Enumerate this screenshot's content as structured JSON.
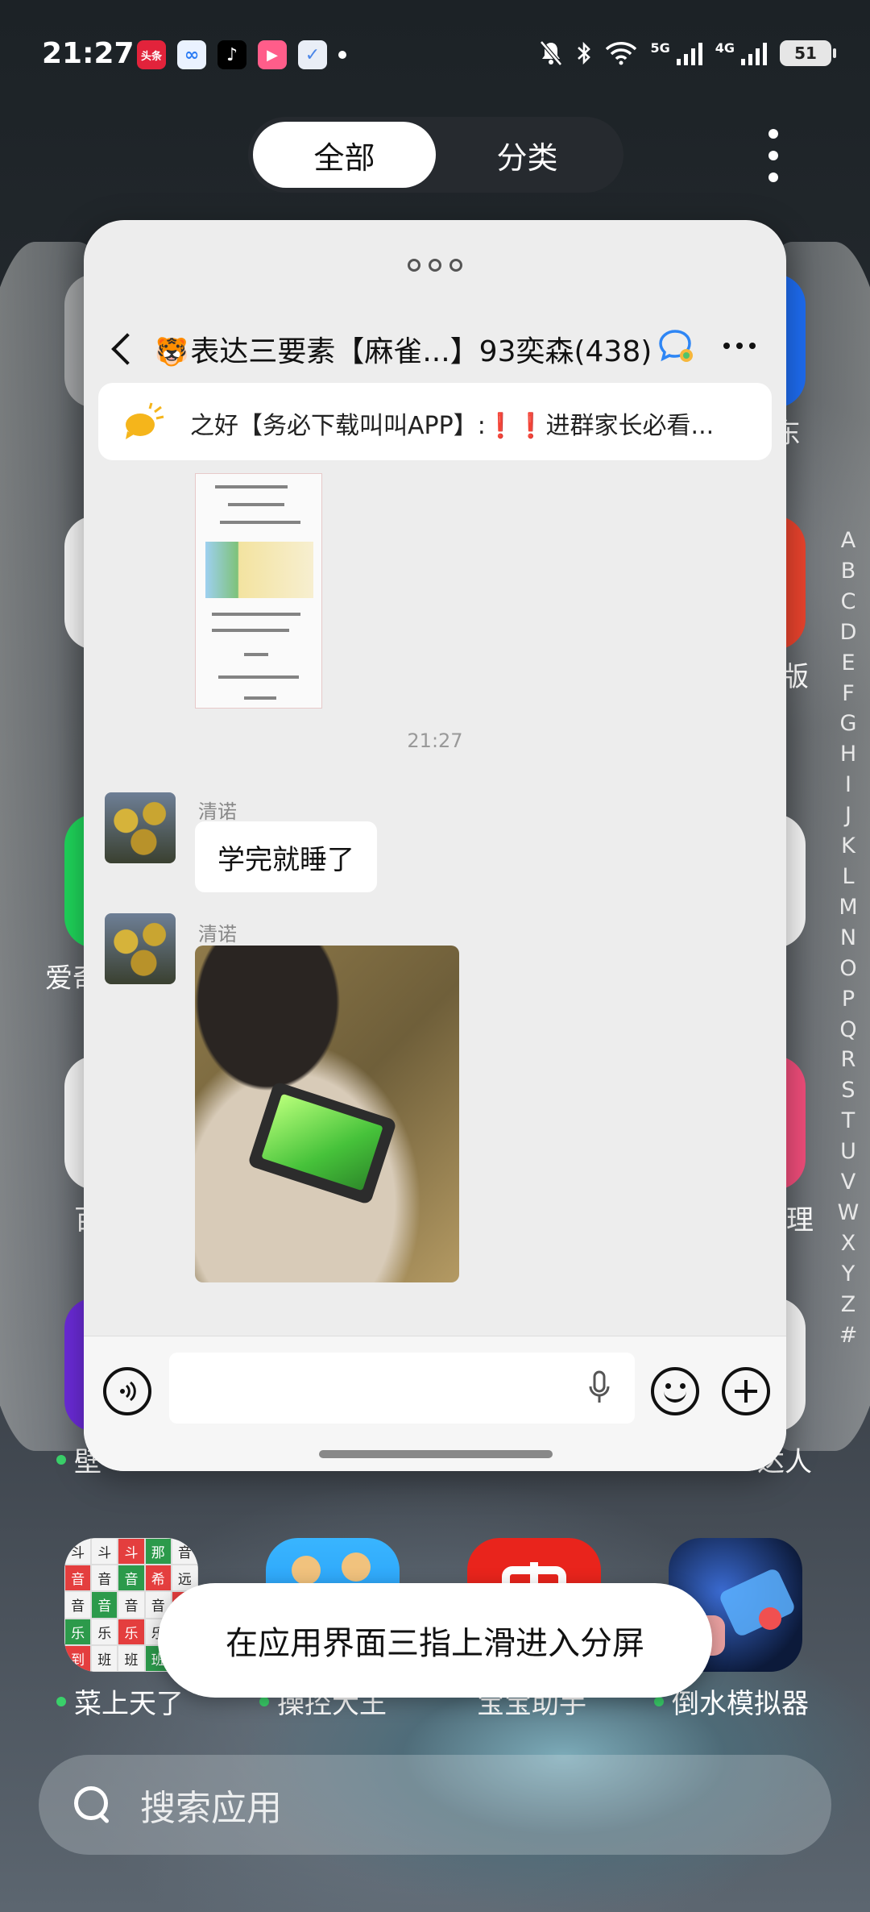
{
  "status_bar": {
    "time": "21:27",
    "notification_icons": [
      "toutiao-icon",
      "baidu-netdisk-icon",
      "tiktok-icon",
      "video-app-icon",
      "task-app-icon"
    ],
    "toutiao_label": "头条",
    "network_5g": "5G",
    "network_4g": "4G",
    "battery_level": "51"
  },
  "top_tabs": {
    "all_label": "全部",
    "category_label": "分类",
    "active": "全部"
  },
  "alphabet_index": [
    "A",
    "B",
    "C",
    "D",
    "E",
    "F",
    "G",
    "H",
    "I",
    "J",
    "K",
    "L",
    "M",
    "N",
    "O",
    "P",
    "Q",
    "R",
    "S",
    "T",
    "U",
    "V",
    "W",
    "X",
    "Y",
    "Z",
    "#"
  ],
  "edge_labels": {
    "left_1": "爱奇",
    "left_2": "百",
    "left_3": "壁",
    "right_1": "东",
    "right_2": "版",
    "right_3": "理",
    "right_4": "达人"
  },
  "chat_window": {
    "title": "表达三要素【麻雀...】93奕森(438)",
    "title_emoji": "🐯",
    "notice_text_before": "之好【务必下载叫叫APP】:",
    "notice_excl": "❗❗",
    "notice_text_after": "进群家长必看...",
    "timestamp": "21:27",
    "messages": [
      {
        "sender": "清诺",
        "text": "学完就睡了"
      },
      {
        "sender": "清诺",
        "type": "image"
      }
    ]
  },
  "apps": [
    {
      "name": "菜上天了",
      "has_dot": true
    },
    {
      "name": "操控大王",
      "has_dot": true
    },
    {
      "name": "宝宝助手",
      "has_dot": false
    },
    {
      "name": "倒水模拟器",
      "has_dot": true
    }
  ],
  "toast": "在应用界面三指上滑进入分屏",
  "search": {
    "placeholder": "搜索应用"
  },
  "colors": {
    "online_dot": "#3ad06a",
    "notice_excl": "#e23a2e",
    "window_bg": "#ededed"
  }
}
